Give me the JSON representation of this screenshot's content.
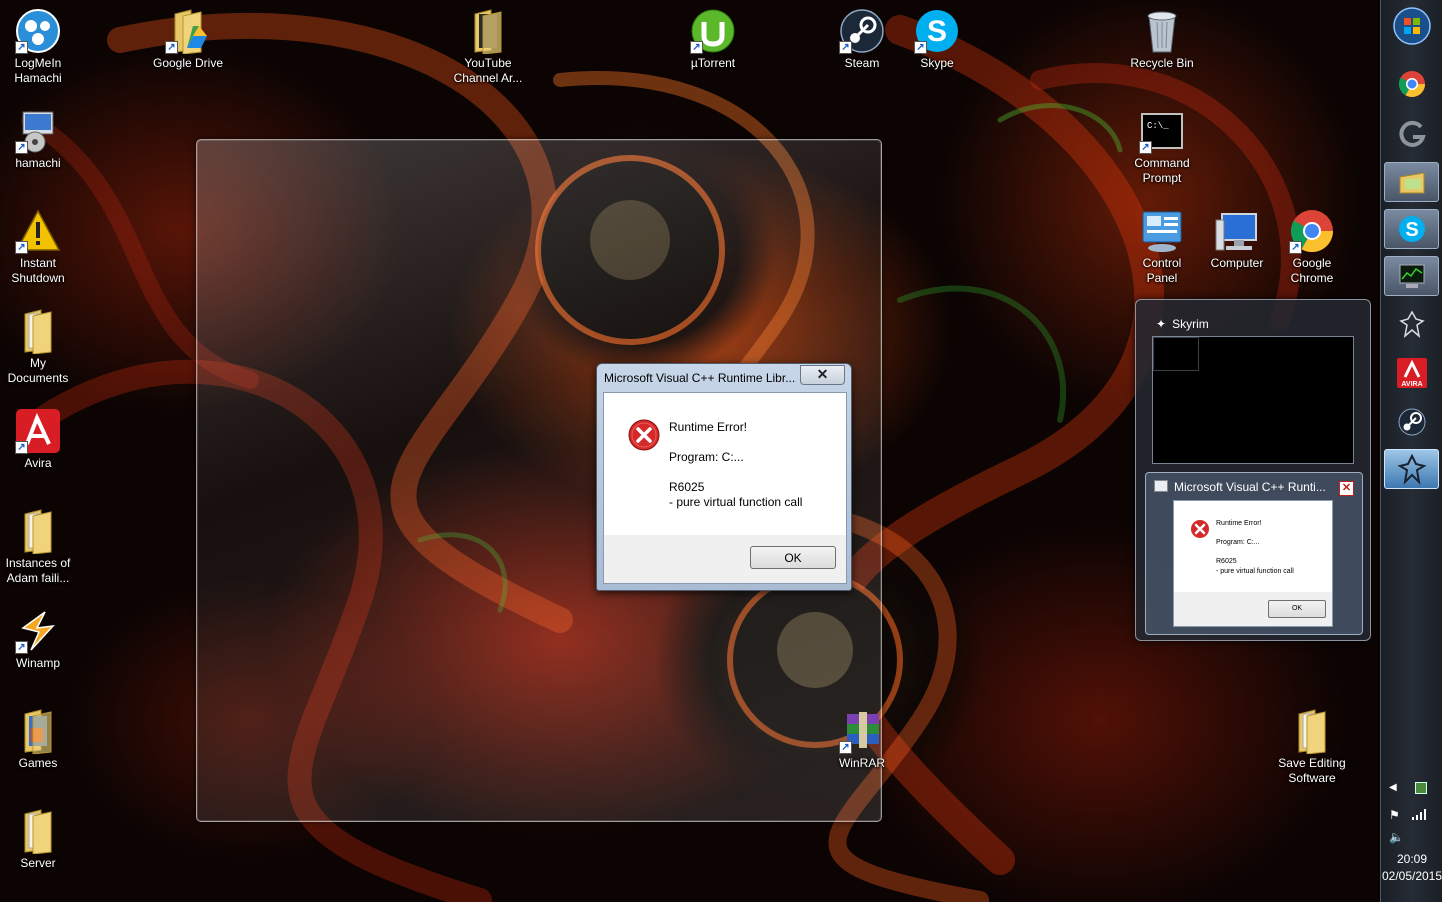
{
  "desktop": {
    "icons": [
      {
        "label": "LogMeIn Hamachi",
        "line1": "LogMeIn",
        "line2": "Hamachi",
        "icon": "hamachi-icon"
      },
      {
        "label": "hamachi",
        "line1": "hamachi",
        "line2": "",
        "icon": "installer-icon"
      },
      {
        "label": "Instant Shutdown",
        "line1": "Instant",
        "line2": "Shutdown",
        "icon": "warning-icon"
      },
      {
        "label": "My Documents",
        "line1": "My",
        "line2": "Documents",
        "icon": "folder-icon"
      },
      {
        "label": "Avira",
        "line1": "Avira",
        "line2": "",
        "icon": "avira-icon"
      },
      {
        "label": "Instances of Adam faili...",
        "line1": "Instances of",
        "line2": "Adam faili...",
        "icon": "folder-icon"
      },
      {
        "label": "Winamp",
        "line1": "Winamp",
        "line2": "",
        "icon": "winamp-icon"
      },
      {
        "label": "Games",
        "line1": "Games",
        "line2": "",
        "icon": "folder-icon"
      },
      {
        "label": "Server",
        "line1": "Server",
        "line2": "",
        "icon": "folder-icon"
      },
      {
        "label": "Google Drive",
        "line1": "Google Drive",
        "line2": "",
        "icon": "google-drive-icon"
      },
      {
        "label": "YouTube Channel Ar...",
        "line1": "YouTube",
        "line2": "Channel Ar...",
        "icon": "folder-icon"
      },
      {
        "label": "µTorrent",
        "line1": "µTorrent",
        "line2": "",
        "icon": "utorrent-icon"
      },
      {
        "label": "Steam",
        "line1": "Steam",
        "line2": "",
        "icon": "steam-icon"
      },
      {
        "label": "Skype",
        "line1": "Skype",
        "line2": "",
        "icon": "skype-icon"
      },
      {
        "label": "Recycle Bin",
        "line1": "Recycle Bin",
        "line2": "",
        "icon": "recycle-bin-icon"
      },
      {
        "label": "Command Prompt",
        "line1": "Command",
        "line2": "Prompt",
        "icon": "command-prompt-icon"
      },
      {
        "label": "Control Panel",
        "line1": "Control",
        "line2": "Panel",
        "icon": "control-panel-icon"
      },
      {
        "label": "Computer",
        "line1": "Computer",
        "line2": "",
        "icon": "computer-icon"
      },
      {
        "label": "Google Chrome",
        "line1": "Google",
        "line2": "Chrome",
        "icon": "chrome-icon"
      },
      {
        "label": "WinRAR",
        "line1": "WinRAR",
        "line2": "",
        "icon": "winrar-icon"
      },
      {
        "label": "Save Editing Software",
        "line1": "Save Editing",
        "line2": "Software",
        "icon": "folder-icon"
      }
    ]
  },
  "dialog": {
    "title": "Microsoft Visual C++ Runtime Libr...",
    "close_label": "✕",
    "lines": [
      "Runtime Error!",
      "",
      "Program: C:...",
      "",
      "R6025",
      "- pure virtual function call"
    ],
    "ok_label": "OK"
  },
  "thumbnails": {
    "skyrim_title": "Skyrim",
    "vc_title": "Microsoft Visual C++ Runti...",
    "vc_close": "✕",
    "mini_lines": [
      "Runtime Error!",
      "",
      "Program: C:...",
      "",
      "R6025",
      "- pure virtual function call"
    ],
    "mini_ok": "OK"
  },
  "taskbar": {
    "buttons": [
      {
        "icon": "start-orb-icon"
      },
      {
        "icon": "chrome-icon"
      },
      {
        "icon": "logitech-gaming-icon"
      },
      {
        "icon": "windows-explorer-icon"
      },
      {
        "icon": "skype-icon"
      },
      {
        "icon": "task-manager-icon"
      },
      {
        "icon": "skyrim-icon"
      },
      {
        "icon": "avira-icon",
        "label": "AVIRA"
      },
      {
        "icon": "steam-icon"
      },
      {
        "icon": "skyrim-icon"
      }
    ],
    "time": "20:09",
    "date": "02/05/2015"
  },
  "colors": {
    "accent_red": "#d32020",
    "dialog_titlebar": "#b8c9de",
    "taskbar": "#1f252d"
  }
}
